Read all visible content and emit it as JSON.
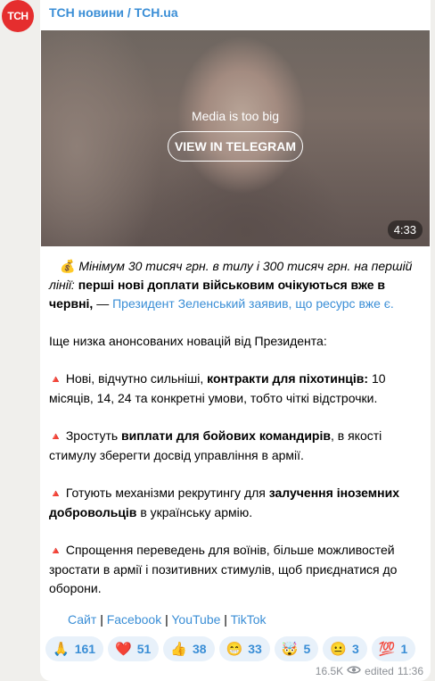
{
  "channel": {
    "avatar_text": "ТСН",
    "name": "ТСН новини / TCH.ua"
  },
  "media": {
    "notice": "Media is too big",
    "button_label": "VIEW IN TELEGRAM",
    "duration": "4:33"
  },
  "post": {
    "line1_emoji": "💰",
    "line1_italic": "Мінімум 30 тисяч грн. в тилу і 300 тисяч грн. на першій лінії:",
    "line1_bold": "перші нові доплати військовим очікуються вже в червні,",
    "line1_dash": "—",
    "line1_link": "Президент Зеленський заявив, що ресурс вже є.",
    "intro": "Іще низка анонсованих новацій від Президента:",
    "bullet_icon": "🔺",
    "item1_a": "Нові, відчутно сильніші,",
    "item1_bold": "контракти для піхотинців:",
    "item1_b": "10 місяців, 14, 24 та конкретні умови, тобто чіткі відстрочки.",
    "item2_a": "Зростуть",
    "item2_bold": "виплати для бойових командирів",
    "item2_b": ", в якості стимулу зберегти досвід управління в армії.",
    "item3_a": "Готують механізми рекрутингу для",
    "item3_bold": "залучення іноземних добровольців",
    "item3_b": "в українську армію.",
    "item4": "Спрощення переведень для воїнів, більше можливостей зростати в армії і позитивних стимулів, щоб приєднатися до оборони."
  },
  "links": {
    "site": "Сайт",
    "sep": "|",
    "facebook": "Facebook",
    "youtube": "YouTube",
    "tiktok": "TikTok"
  },
  "reactions": [
    {
      "emoji": "🙏",
      "count": "161"
    },
    {
      "emoji": "❤️",
      "count": "51"
    },
    {
      "emoji": "👍",
      "count": "38"
    },
    {
      "emoji": "😁",
      "count": "33"
    },
    {
      "emoji": "🤯",
      "count": "5"
    },
    {
      "emoji": "😐",
      "count": "3"
    },
    {
      "emoji": "💯",
      "count": "1"
    }
  ],
  "footer": {
    "views": "16.5K",
    "edited": "edited",
    "time": "11:36"
  },
  "colors": {
    "accent": "#3a8ed6",
    "avatar_bg": "#e52e2e",
    "reaction_bg": "#e8f1fa"
  }
}
